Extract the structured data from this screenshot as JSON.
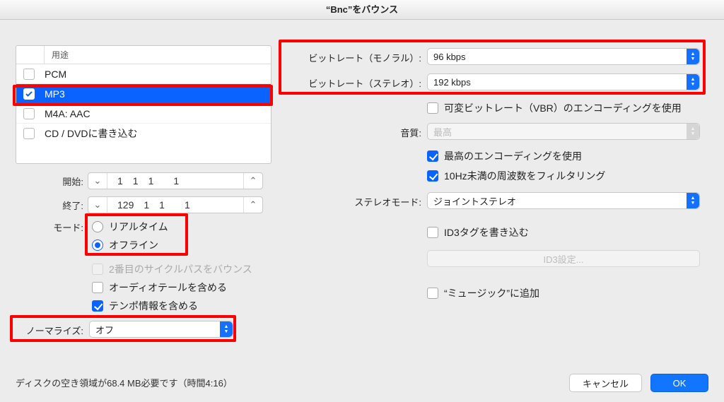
{
  "title": "“Bnc”をバウンス",
  "formats": {
    "header": "用途",
    "items": [
      {
        "label": "PCM",
        "checked": false,
        "selected": false
      },
      {
        "label": "MP3",
        "checked": true,
        "selected": true
      },
      {
        "label": "M4A: AAC",
        "checked": false,
        "selected": false
      },
      {
        "label": "CD / DVDに書き込む",
        "checked": false,
        "selected": false
      }
    ]
  },
  "range": {
    "start_label": "開始:",
    "start_values": [
      "1",
      "1",
      "1",
      "",
      "1"
    ],
    "end_label": "終了:",
    "end_values": [
      "129",
      "1",
      "1",
      "",
      "1"
    ]
  },
  "mode": {
    "label": "モード:",
    "realtime": "リアルタイム",
    "offline": "オフライン",
    "selected": "offline"
  },
  "second_cycle": {
    "label": "2番目のサイクルパスをバウンス",
    "checked": false,
    "enabled": false
  },
  "audio_tail": {
    "label": "オーディオテールを含める",
    "checked": false
  },
  "tempo_info": {
    "label": "テンポ情報を含める",
    "checked": true
  },
  "normalize": {
    "label": "ノーマライズ:",
    "value": "オフ"
  },
  "bitrate_mono": {
    "label": "ビットレート（モノラル）:",
    "value": "96 kbps"
  },
  "bitrate_stereo": {
    "label": "ビットレート（ステレオ）:",
    "value": "192 kbps"
  },
  "vbr": {
    "label": "可変ビットレート（VBR）のエンコーディングを使用",
    "checked": false
  },
  "quality": {
    "label": "音質:",
    "value": "最高",
    "enabled": false
  },
  "best_encoding": {
    "label": "最高のエンコーディングを使用",
    "checked": true
  },
  "filter_10hz": {
    "label": "10Hz未満の周波数をフィルタリング",
    "checked": true
  },
  "stereo_mode": {
    "label": "ステレオモード:",
    "value": "ジョイントステレオ"
  },
  "id3_write": {
    "label": "ID3タグを書き込む",
    "checked": false
  },
  "id3_settings": "ID3設定...",
  "add_to_music": {
    "label": "“ミュージック”に追加",
    "checked": false
  },
  "disk_status": "ディスクの空き領域が68.4 MB必要です（時間4:16）",
  "buttons": {
    "cancel": "キャンセル",
    "ok": "OK"
  }
}
